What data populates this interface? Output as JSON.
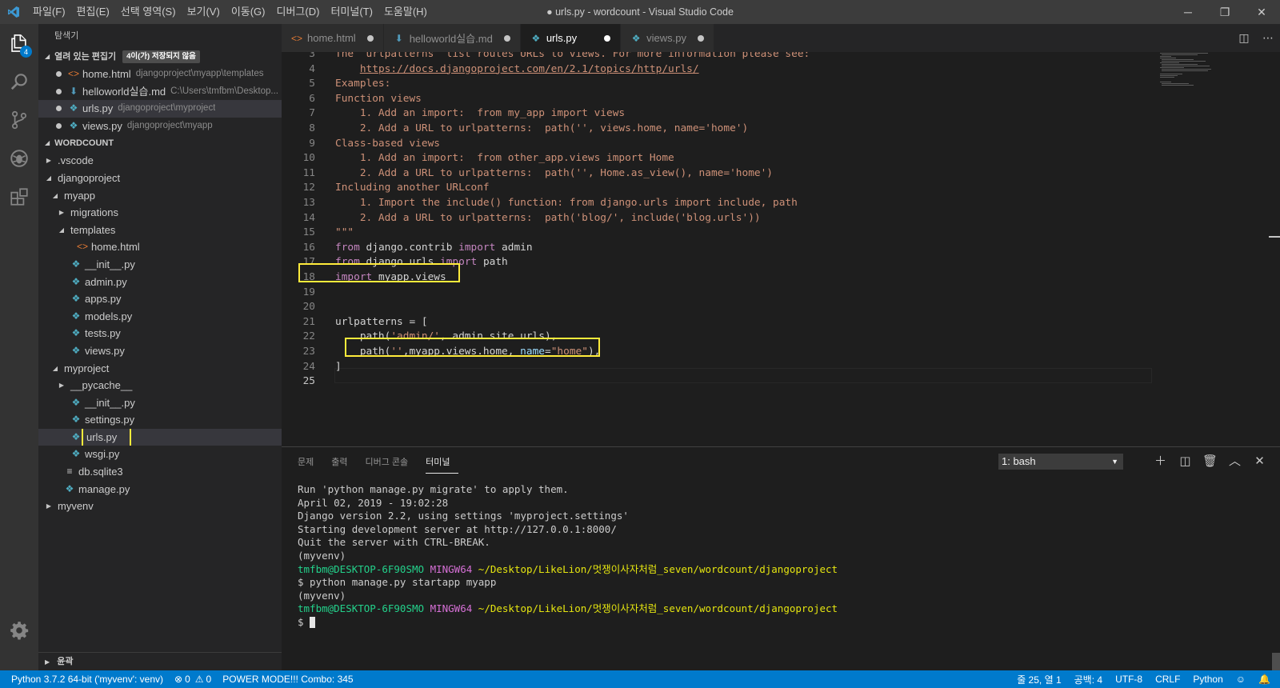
{
  "window": {
    "title": "● urls.py - wordcount - Visual Studio Code",
    "menu": [
      "파일(F)",
      "편집(E)",
      "선택 영역(S)",
      "보기(V)",
      "이동(G)",
      "디버그(D)",
      "터미널(T)",
      "도움말(H)"
    ],
    "controls": {
      "minimize": "─",
      "restore": "❐",
      "close": "✕"
    }
  },
  "activity_bar": {
    "explorer_badge": "4"
  },
  "sidebar": {
    "header": "탐색기",
    "open_editors": {
      "label": "열려 있는 편집기",
      "dirty_badge": "4이(가) 저장되지 않음",
      "items": [
        {
          "name": "home.html",
          "path": "djangoproject\\myapp\\templates",
          "icon": "html-icon"
        },
        {
          "name": "helloworld실습.md",
          "path": "C:\\Users\\tmfbm\\Desktop...",
          "icon": "markdown-icon"
        },
        {
          "name": "urls.py",
          "path": "djangoproject\\myproject",
          "icon": "python-icon"
        },
        {
          "name": "views.py",
          "path": "djangoproject\\myapp",
          "icon": "python-icon"
        }
      ]
    },
    "workspace": {
      "label": "WORDCOUNT",
      "tree": [
        {
          "name": ".vscode",
          "type": "folder",
          "depth": 1,
          "expanded": false
        },
        {
          "name": "djangoproject",
          "type": "folder",
          "depth": 1,
          "expanded": true
        },
        {
          "name": "myapp",
          "type": "folder",
          "depth": 2,
          "expanded": true
        },
        {
          "name": "migrations",
          "type": "folder",
          "depth": 3,
          "expanded": false
        },
        {
          "name": "templates",
          "type": "folder",
          "depth": 3,
          "expanded": true
        },
        {
          "name": "home.html",
          "type": "html",
          "depth": 4
        },
        {
          "name": "__init__.py",
          "type": "py",
          "depth": 3
        },
        {
          "name": "admin.py",
          "type": "py",
          "depth": 3
        },
        {
          "name": "apps.py",
          "type": "py",
          "depth": 3
        },
        {
          "name": "models.py",
          "type": "py",
          "depth": 3
        },
        {
          "name": "tests.py",
          "type": "py",
          "depth": 3
        },
        {
          "name": "views.py",
          "type": "py",
          "depth": 3
        },
        {
          "name": "myproject",
          "type": "folder",
          "depth": 2,
          "expanded": true
        },
        {
          "name": "__pycache__",
          "type": "folder",
          "depth": 3,
          "expanded": false
        },
        {
          "name": "__init__.py",
          "type": "py",
          "depth": 3
        },
        {
          "name": "settings.py",
          "type": "py",
          "depth": 3
        },
        {
          "name": "urls.py",
          "type": "py",
          "depth": 3,
          "selected": true
        },
        {
          "name": "wsgi.py",
          "type": "py",
          "depth": 3
        },
        {
          "name": "db.sqlite3",
          "type": "db",
          "depth": 2
        },
        {
          "name": "manage.py",
          "type": "py",
          "depth": 2
        },
        {
          "name": "myvenv",
          "type": "folder",
          "depth": 1,
          "expanded": false
        }
      ]
    },
    "outline_label": "윤곽"
  },
  "tabs": [
    {
      "label": "home.html",
      "icon": "html-icon",
      "active": false
    },
    {
      "label": "helloworld실습.md",
      "icon": "markdown-icon",
      "active": false
    },
    {
      "label": "urls.py",
      "icon": "python-icon",
      "active": true
    },
    {
      "label": "views.py",
      "icon": "python-icon",
      "active": false
    }
  ],
  "editor": {
    "current_line": 25,
    "lines": [
      {
        "n": "3",
        "segs": [
          {
            "t": "The `urlpatterns` list routes URLs to views. For more information please see:",
            "c": "c-doc"
          }
        ]
      },
      {
        "n": "4",
        "segs": [
          {
            "t": "    ",
            "c": ""
          },
          {
            "t": "https://docs.djangoproject.com/en/2.1/topics/http/urls/",
            "c": "c-url"
          }
        ]
      },
      {
        "n": "5",
        "segs": [
          {
            "t": "Examples:",
            "c": "c-doc"
          }
        ]
      },
      {
        "n": "6",
        "segs": [
          {
            "t": "Function views",
            "c": "c-doc"
          }
        ]
      },
      {
        "n": "7",
        "segs": [
          {
            "t": "    1. Add an import:  from my_app import views",
            "c": "c-doc"
          }
        ]
      },
      {
        "n": "8",
        "segs": [
          {
            "t": "    2. Add a URL to urlpatterns:  path('', views.home, name='home')",
            "c": "c-doc"
          }
        ]
      },
      {
        "n": "9",
        "segs": [
          {
            "t": "Class-based views",
            "c": "c-doc"
          }
        ]
      },
      {
        "n": "10",
        "segs": [
          {
            "t": "    1. Add an import:  from other_app.views import Home",
            "c": "c-doc"
          }
        ]
      },
      {
        "n": "11",
        "segs": [
          {
            "t": "    2. Add a URL to urlpatterns:  path('', Home.as_view(), name='home')",
            "c": "c-doc"
          }
        ]
      },
      {
        "n": "12",
        "segs": [
          {
            "t": "Including another URLconf",
            "c": "c-doc"
          }
        ]
      },
      {
        "n": "13",
        "segs": [
          {
            "t": "    1. Import the include() function: from django.urls import include, path",
            "c": "c-doc"
          }
        ]
      },
      {
        "n": "14",
        "segs": [
          {
            "t": "    2. Add a URL to urlpatterns:  path('blog/', include('blog.urls'))",
            "c": "c-doc"
          }
        ]
      },
      {
        "n": "15",
        "segs": [
          {
            "t": "\"\"\"",
            "c": "c-doc"
          }
        ]
      },
      {
        "n": "16",
        "segs": [
          {
            "t": "from",
            "c": "c-kw"
          },
          {
            "t": " django.contrib ",
            "c": ""
          },
          {
            "t": "import",
            "c": "c-kw"
          },
          {
            "t": " admin",
            "c": ""
          }
        ]
      },
      {
        "n": "17",
        "segs": [
          {
            "t": "from",
            "c": "c-kw"
          },
          {
            "t": " django.urls ",
            "c": ""
          },
          {
            "t": "import",
            "c": "c-kw"
          },
          {
            "t": " path",
            "c": ""
          }
        ]
      },
      {
        "n": "18",
        "segs": [
          {
            "t": "import",
            "c": "c-kw"
          },
          {
            "t": " myapp.views",
            "c": ""
          }
        ]
      },
      {
        "n": "19",
        "segs": []
      },
      {
        "n": "20",
        "segs": []
      },
      {
        "n": "21",
        "segs": [
          {
            "t": "urlpatterns = [",
            "c": ""
          }
        ]
      },
      {
        "n": "22",
        "segs": [
          {
            "t": "    path(",
            "c": ""
          },
          {
            "t": "'admin/'",
            "c": "c-str"
          },
          {
            "t": ", admin.site.urls),",
            "c": ""
          }
        ]
      },
      {
        "n": "23",
        "segs": [
          {
            "t": "    path(",
            "c": ""
          },
          {
            "t": "''",
            "c": "c-str"
          },
          {
            "t": ",myapp.views.home, ",
            "c": ""
          },
          {
            "t": "name",
            "c": "c-param"
          },
          {
            "t": "=",
            "c": ""
          },
          {
            "t": "\"home\"",
            "c": "c-str"
          },
          {
            "t": "),",
            "c": ""
          }
        ]
      },
      {
        "n": "24",
        "segs": [
          {
            "t": "]",
            "c": ""
          }
        ]
      },
      {
        "n": "25",
        "segs": []
      }
    ]
  },
  "panel": {
    "tabs": [
      "문제",
      "출력",
      "디버그 콘솔",
      "터미널"
    ],
    "active_tab": "터미널",
    "terminal_select": "1: bash",
    "terminal_lines": [
      [
        {
          "t": "Run 'python manage.py migrate' to apply them.",
          "c": ""
        }
      ],
      [
        {
          "t": "April 02, 2019 - 19:02:28",
          "c": ""
        }
      ],
      [
        {
          "t": "Django version 2.2, using settings 'myproject.settings'",
          "c": ""
        }
      ],
      [
        {
          "t": "Starting development server at http://127.0.0.1:8000/",
          "c": ""
        }
      ],
      [
        {
          "t": "Quit the server with CTRL-BREAK.",
          "c": ""
        }
      ],
      [
        {
          "t": "(myvenv)",
          "c": ""
        }
      ],
      [
        {
          "t": "tmfbm@DESKTOP-6F90SMO",
          "c": "t-green"
        },
        {
          "t": " ",
          "c": ""
        },
        {
          "t": "MINGW64",
          "c": "t-mag"
        },
        {
          "t": " ~/Desktop/LikeLion/멋쟁이사자처럼_seven/wordcount/djangoproject",
          "c": "t-yel"
        }
      ],
      [
        {
          "t": "$ python manage.py startapp myapp",
          "c": ""
        }
      ],
      [
        {
          "t": "(myvenv)",
          "c": ""
        }
      ],
      [
        {
          "t": "tmfbm@DESKTOP-6F90SMO",
          "c": "t-green"
        },
        {
          "t": " ",
          "c": ""
        },
        {
          "t": "MINGW64",
          "c": "t-mag"
        },
        {
          "t": " ~/Desktop/LikeLion/멋쟁이사자처럼_seven/wordcount/djangoproject",
          "c": "t-yel"
        }
      ],
      [
        {
          "t": "$ ",
          "c": ""
        }
      ]
    ]
  },
  "status_bar": {
    "interpreter": "Python 3.7.2 64-bit ('myvenv': venv)",
    "errors": "0",
    "warnings": "0",
    "power_mode": "POWER MODE!!! Combo: 345",
    "position": "줄 25, 열 1",
    "spaces": "공백: 4",
    "encoding": "UTF-8",
    "eol": "CRLF",
    "language": "Python"
  },
  "colors": {
    "accent": "#007acc",
    "highlight_box": "#ffeb3b",
    "keyword": "#c586c0",
    "string": "#ce9178"
  }
}
